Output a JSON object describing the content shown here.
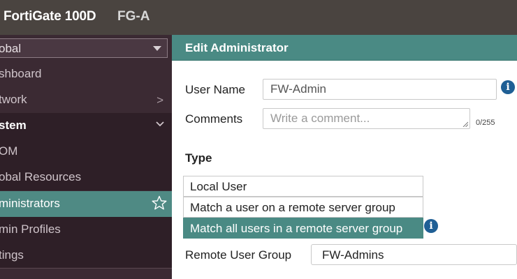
{
  "topbar": {
    "device": "FortiGate 100D",
    "hostname": "FG-A"
  },
  "sidebar": {
    "vdom_selector": {
      "value": "obal"
    },
    "items": [
      {
        "label": "shboard",
        "kind": "item"
      },
      {
        "label": "twork",
        "kind": "item",
        "chevron": ">"
      },
      {
        "label": "stem",
        "kind": "section",
        "chevron": "⌄"
      },
      {
        "label": "OM",
        "kind": "sub"
      },
      {
        "label": "obal Resources",
        "kind": "sub"
      },
      {
        "label": "ministrators",
        "kind": "active",
        "icon": "star-icon"
      },
      {
        "label": "min Profiles",
        "kind": "sub"
      },
      {
        "label": "tings",
        "kind": "sub"
      }
    ]
  },
  "panel": {
    "title": "Edit Administrator",
    "user_name": {
      "label": "User Name",
      "value": "FW-Admin"
    },
    "comments": {
      "label": "Comments",
      "placeholder": "Write a comment...",
      "counter": "0/255"
    },
    "type": {
      "label": "Type",
      "options": [
        {
          "label": "Local User",
          "selected": false
        },
        {
          "label": "Match a user on a remote server group",
          "selected": false
        },
        {
          "label": "Match all users in a remote server group",
          "selected": true
        }
      ]
    },
    "remote_group": {
      "label": "Remote User Group",
      "value": "FW-Admins"
    }
  },
  "colors": {
    "accent": "#4a8a84",
    "sidebar": "#3b2a33",
    "topbar": "#4a4440",
    "info": "#1f5f95"
  }
}
